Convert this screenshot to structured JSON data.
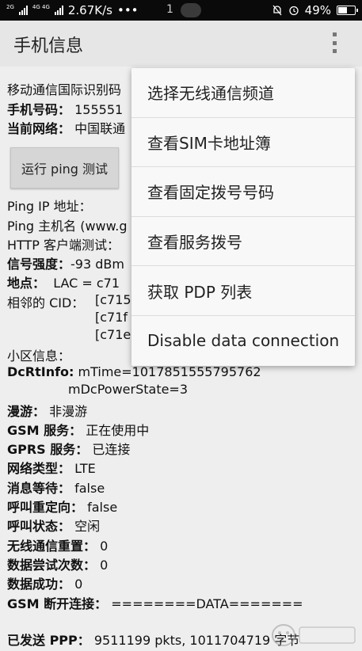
{
  "status_bar": {
    "network_tag_1": "2G",
    "network_tag_2": "4G 4G",
    "speed": "2.67K/s",
    "dots": "•••",
    "time_fragment": "1",
    "battery_text": "49%",
    "battery_level": 0.49
  },
  "app_bar": {
    "title": "手机信息"
  },
  "info": {
    "imei_label": "移动通信国际识别码",
    "phone_label": "手机号码：",
    "phone_value": "155551",
    "network_label": "当前网络：",
    "network_value": "中国联通",
    "ping_button": "运行 ping 测试",
    "ping_ip_label": "Ping IP 地址：",
    "ping_host_label": "Ping 主机名 (www.g",
    "http_label": "HTTP 客户端测试：",
    "signal_label": "信号强度：",
    "signal_value": "-93 dBm",
    "location_label": "地点：",
    "location_value": "LAC = c71",
    "neighbor_label": "相邻的 CID：",
    "neighbor_values": [
      "[c715",
      "[c71f",
      "[c71e"
    ],
    "cell_info_label": "小区信息：",
    "dcrt_label": "DcRtInfo:",
    "dcrt_line1": "mTime=1017851555795762",
    "dcrt_line2": "mDcPowerState=3",
    "roaming_label": "漫游：",
    "roaming_value": "非漫游",
    "gsm_service_label": "GSM 服务：",
    "gsm_service_value": "正在使用中",
    "gprs_service_label": "GPRS 服务：",
    "gprs_service_value": "已连接",
    "net_type_label": "网络类型：",
    "net_type_value": "LTE",
    "msg_waiting_label": "消息等待：",
    "msg_waiting_value": "false",
    "call_redirect_label": "呼叫重定向：",
    "call_redirect_value": "false",
    "call_state_label": "呼叫状态：",
    "call_state_value": "空闲",
    "radio_reset_label": "无线通信重置：",
    "radio_reset_value": "0",
    "data_attempts_label": "数据尝试次数：",
    "data_attempts_value": "0",
    "data_success_label": "数据成功：",
    "data_success_value": "0",
    "gsm_disconnect_label": "GSM 断开连接：",
    "gsm_disconnect_value": "========DATA=======",
    "ppp_sent_label": "已发送 PPP：",
    "ppp_sent_value": "9511199 pkts, 1011704719 字节"
  },
  "menu": {
    "items": [
      "选择无线通信频道",
      "查看SIM卡地址簿",
      "查看固定拨号号码",
      "查看服务拨号",
      "获取 PDP 列表",
      "Disable data connection"
    ]
  }
}
